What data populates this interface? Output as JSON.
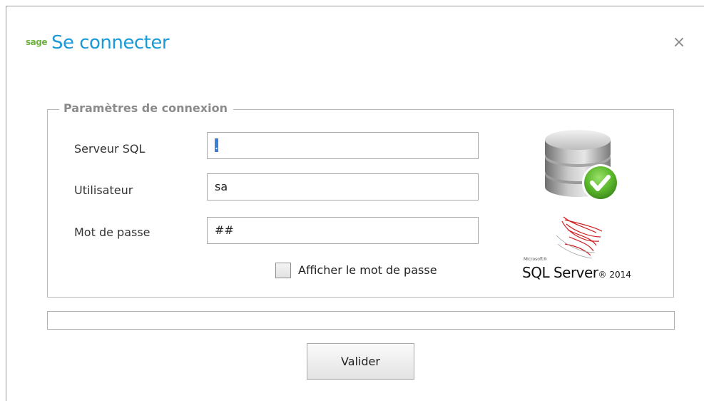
{
  "dialog": {
    "brand": "sage",
    "title": "Se connecter",
    "close_icon": "close-icon",
    "close_glyph": "×"
  },
  "connection": {
    "legend": "Paramètres de connexion",
    "server_label": "Serveur SQL",
    "server_value": ".",
    "user_label": "Utilisateur",
    "user_value": "sa",
    "password_label": "Mot de passe",
    "password_value": "##",
    "show_password_label": "Afficher le mot de passe",
    "show_password_checked": false
  },
  "images": {
    "database_icon": "database-check-icon",
    "sql_server_logo": {
      "maker": "Microsoft®",
      "product": "SQL Server",
      "version": "2014"
    }
  },
  "progress": {
    "value": 0
  },
  "actions": {
    "submit_label": "Valider"
  },
  "colors": {
    "title": "#1a9ad6",
    "brand": "#6cb33e",
    "check_green": "#5cb82c",
    "sql_red": "#cc1f1f"
  }
}
